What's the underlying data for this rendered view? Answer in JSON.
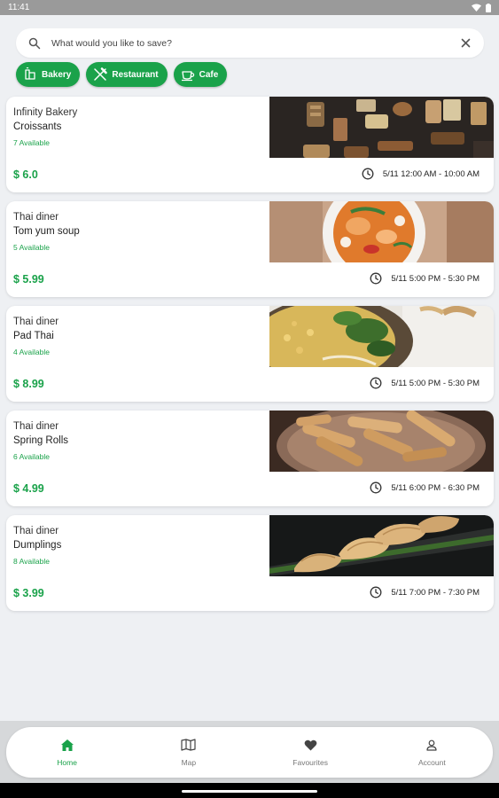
{
  "status_bar": {
    "time": "11:41"
  },
  "search": {
    "placeholder": "What would you like to save?"
  },
  "chips": [
    {
      "label": "Bakery",
      "icon": "bakery-icon"
    },
    {
      "label": "Restaurant",
      "icon": "utensils-icon"
    },
    {
      "label": "Cafe",
      "icon": "coffee-cup-icon"
    }
  ],
  "listings": [
    {
      "store": "Infinity Bakery",
      "item": "Croissants",
      "available": "7 Available",
      "price": "$ 6.0",
      "pickup": "5/11 12:00 AM - 10:00 AM",
      "image": "baked-goods-photo"
    },
    {
      "store": "Thai diner",
      "item": "Tom yum soup",
      "available": "5 Available",
      "price": "$ 5.99",
      "pickup": "5/11 5:00 PM - 5:30 PM",
      "image": "tom-yum-soup-photo"
    },
    {
      "store": "Thai diner",
      "item": "Pad Thai",
      "available": "4 Available",
      "price": "$ 8.99",
      "pickup": "5/11 5:00 PM - 5:30 PM",
      "image": "pad-thai-photo"
    },
    {
      "store": "Thai diner",
      "item": "Spring Rolls",
      "available": "6 Available",
      "price": "$ 4.99",
      "pickup": "5/11 6:00 PM - 6:30 PM",
      "image": "spring-rolls-photo"
    },
    {
      "store": "Thai diner",
      "item": "Dumplings",
      "available": "8 Available",
      "price": "$ 3.99",
      "pickup": "5/11 7:00 PM - 7:30 PM",
      "image": "dumplings-photo"
    }
  ],
  "nav": [
    {
      "label": "Home",
      "icon": "home-icon",
      "active": true
    },
    {
      "label": "Map",
      "icon": "map-icon",
      "active": false
    },
    {
      "label": "Favourites",
      "icon": "heart-icon",
      "active": false
    },
    {
      "label": "Account",
      "icon": "person-icon",
      "active": false
    }
  ],
  "colors": {
    "accent": "#1aa24a",
    "background": "#eef0f3"
  }
}
